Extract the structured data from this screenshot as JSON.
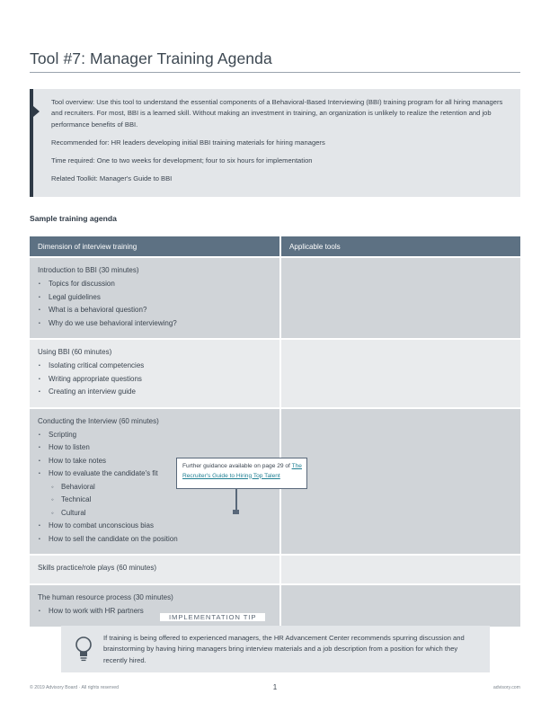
{
  "document": {
    "title": "Tool #7: Manager Training Agenda"
  },
  "overview": {
    "paragraph1": "Tool overview: Use this tool to understand the essential components of a Behavioral-Based Interviewing (BBI) training program for all hiring managers and recruiters. For most, BBI is a learned skill. Without making an investment in training, an organization is unlikely to realize the retention and job performance benefits of BBI.",
    "paragraph2": "Recommended for: HR leaders developing initial BBI training materials for hiring managers",
    "paragraph3": "Time required: One to two weeks for development; four to six hours for implementation",
    "paragraph4": "Related Toolkit: Manager's Guide to BBI"
  },
  "section": {
    "heading": "Sample training agenda"
  },
  "table": {
    "headers": {
      "col_a": "Dimension of interview training",
      "col_b": "Applicable tools"
    },
    "rows": [
      {
        "title": "Introduction to BBI (30 minutes)",
        "items": [
          {
            "text": "Topics for discussion",
            "level": 1
          },
          {
            "text": "Legal guidelines",
            "level": 1
          },
          {
            "text": "What is a behavioral question?",
            "level": 1
          },
          {
            "text": "Why do we use behavioral interviewing?",
            "level": 1
          }
        ],
        "tools": ""
      },
      {
        "title": "Using BBI (60 minutes)",
        "items": [
          {
            "text": "Isolating critical competencies",
            "level": 1
          },
          {
            "text": "Writing appropriate questions",
            "level": 1
          },
          {
            "text": "Creating an interview guide",
            "level": 1
          }
        ],
        "tools": ""
      },
      {
        "title": "Conducting the Interview (60 minutes)",
        "items": [
          {
            "text": "Scripting",
            "level": 1
          },
          {
            "text": "How to listen",
            "level": 1
          },
          {
            "text": "How to take notes",
            "level": 1
          },
          {
            "text": "How to evaluate the candidate's fit",
            "level": 1
          },
          {
            "text": "Behavioral",
            "level": 2
          },
          {
            "text": "Technical",
            "level": 2
          },
          {
            "text": "Cultural",
            "level": 2
          },
          {
            "text": "How to combat unconscious bias",
            "level": 1
          },
          {
            "text": "How to sell the candidate on the position",
            "level": 1
          }
        ],
        "tools": ""
      },
      {
        "title": "Skills practice/role plays (60 minutes)",
        "items": [],
        "tools": ""
      },
      {
        "title": "The human resource process (30 minutes)",
        "items": [
          {
            "text": "How to work with HR partners",
            "level": 1
          }
        ],
        "tools": ""
      }
    ]
  },
  "note": {
    "lead_text": "Further guidance available on page 29 of ",
    "link_text": "The Recruiter's Guide to Hiring Top Talent"
  },
  "tip": {
    "label": "IMPLEMENTATION TIP",
    "body": "If training is being offered to experienced managers, the HR Advancement Center recommends spurring discussion and brainstorming by having hiring managers bring interview materials and a job description from a position for which they recently hired."
  },
  "footer": {
    "copyright": "© 2019 Advisory Board · All rights reserved",
    "page_number": "1",
    "site": "advisory.com"
  },
  "colors": {
    "header_slate": "#5d7183",
    "row_dark": "#d0d4d8",
    "row_light": "#e9ebed",
    "callout_bg": "#e3e6e9",
    "accent_bar": "#2f3a46",
    "link_teal": "#1f7f93",
    "text": "#3b4550"
  }
}
